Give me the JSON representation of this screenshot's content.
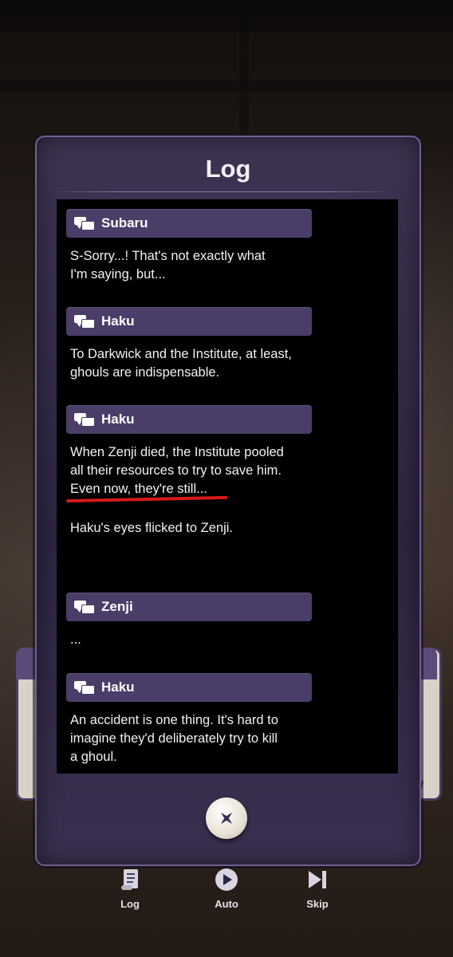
{
  "log_window": {
    "title": "Log",
    "entries": [
      {
        "speaker": "Subaru",
        "text": "S-Sorry...! That's not exactly what\nI'm saying, but..."
      },
      {
        "speaker": "Haku",
        "text": "To Darkwick and the Institute, at least,\nghouls are indispensable."
      },
      {
        "speaker": "Haku",
        "text": "When Zenji died, the Institute pooled\nall their resources to try to save him.\nEven now, they're still..."
      },
      {
        "speaker": "",
        "text": "Haku's eyes flicked to Zenji."
      },
      {
        "speaker": "Zenji",
        "text": "..."
      },
      {
        "speaker": "Haku",
        "text": "An accident is one thing. It's hard to\nimagine they'd deliberately try to kill\na ghoul."
      }
    ],
    "close_icon": "close-x-icon"
  },
  "toolbar": {
    "items": [
      {
        "label": "Log",
        "icon": "scroll-icon"
      },
      {
        "label": "Auto",
        "icon": "play-icon"
      },
      {
        "label": "Skip",
        "icon": "skip-icon"
      }
    ]
  },
  "colors": {
    "panel": "#2e2540",
    "name_bar": "#4a3d68",
    "annotation": "#d61a1a"
  }
}
